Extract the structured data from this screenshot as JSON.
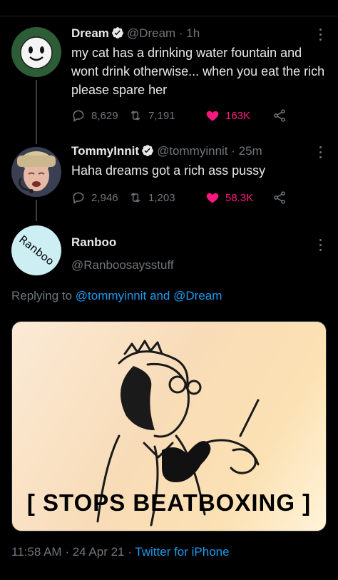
{
  "tweets": [
    {
      "name": "Dream",
      "handle": "@Dream",
      "time": "1h",
      "text": "my cat has a drinking water fountain and wont drink otherwise... when you eat the rich please spare her",
      "replies": "8,629",
      "retweets": "7,191",
      "likes": "163K"
    },
    {
      "name": "TommyInnit",
      "handle": "@tommyinnit",
      "time": "25m",
      "text": "Haha dreams got a rich ass pussy",
      "replies": "2,946",
      "retweets": "1,203",
      "likes": "58.3K"
    }
  ],
  "main": {
    "name": "Ranboo",
    "handle": "@Ranboosaysstuff",
    "avatar_text": "Ranboo",
    "replying_prefix": "Replying to",
    "replying_to_1": "@tommyinnit",
    "replying_and": "and",
    "replying_to_2": "@Dream",
    "media_caption": "[ STOPS BEATBOXING ]",
    "timestamp": "11:58 AM",
    "date": "24 Apr 21",
    "source": "Twitter for iPhone"
  },
  "colors": {
    "background": "#000000",
    "accent": "#1d9bf0",
    "like": "#f91880",
    "muted": "#71767b"
  },
  "icons": [
    "verified-badge-icon",
    "reply-icon",
    "retweet-icon",
    "heart-icon",
    "share-icon",
    "more-icon"
  ]
}
